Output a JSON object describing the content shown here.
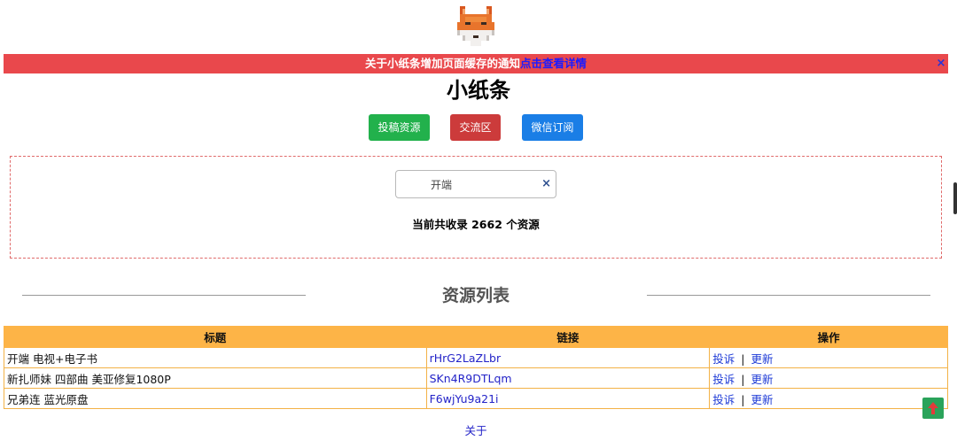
{
  "notice": {
    "text": "关于小纸条增加页面缓存的通知",
    "link_text": "点击查看详情",
    "close_symbol": "×",
    "bg_color": "#e9484c"
  },
  "site": {
    "title": "小纸条"
  },
  "nav": {
    "buttons": [
      {
        "label": "投稿资源",
        "color": "#22b14c"
      },
      {
        "label": "交流区",
        "color": "#cc3b3b"
      },
      {
        "label": "微信订阅",
        "color": "#1a7ee6"
      }
    ]
  },
  "search": {
    "value": "开端",
    "clear_symbol": "×",
    "count_text": "当前共收录 2662 个资源"
  },
  "section": {
    "title": "资源列表"
  },
  "table": {
    "headers": [
      "标题",
      "链接",
      "操作"
    ],
    "rows": [
      {
        "title": "开端 电视+电子书",
        "link": "rHrG2LaZLbr",
        "op1": "投诉",
        "sep": "|",
        "op2": "更新"
      },
      {
        "title": "新扎师妹 四部曲 美亚修复1080P",
        "link": "SKn4R9DTLqm",
        "op1": "投诉",
        "sep": "|",
        "op2": "更新"
      },
      {
        "title": "兄弟连 蓝光原盘",
        "link": "F6wjYu9a21i",
        "op1": "投诉",
        "sep": "|",
        "op2": "更新"
      }
    ],
    "header_color": "#fdb447"
  },
  "footer": {
    "about": "关于"
  },
  "icons": {
    "logo": "fox-logo-icon",
    "back_to_top": "arrow-up-icon"
  }
}
